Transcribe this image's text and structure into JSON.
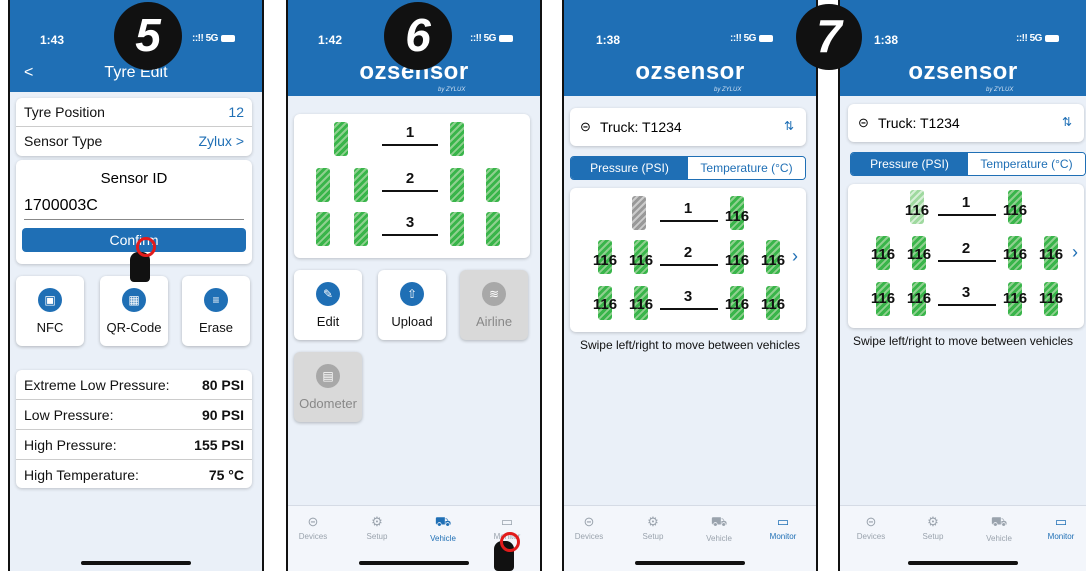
{
  "steps": [
    "5",
    "6",
    "7"
  ],
  "status": {
    "times": [
      "1:43",
      "1:42",
      "1:38",
      "1:38"
    ],
    "signal": "::!! 5G"
  },
  "logo": {
    "text": "ozsensor",
    "sub": "by ZYLUX"
  },
  "p1": {
    "title": "Tyre Edit",
    "back": "<",
    "tyre_position_label": "Tyre Position",
    "tyre_position_value": "12",
    "sensor_type_label": "Sensor Type",
    "sensor_type_value": "Zylux >",
    "sensor_id_label": "Sensor ID",
    "sensor_id_value": "1700003C",
    "confirm": "Confirm",
    "tools": [
      "NFC",
      "QR-Code",
      "Erase"
    ],
    "thresholds": [
      {
        "label": "Extreme Low Pressure:",
        "value": "80 PSI"
      },
      {
        "label": "Low Pressure:",
        "value": "90 PSI"
      },
      {
        "label": "High Pressure:",
        "value": "155 PSI"
      },
      {
        "label": "High Temperature:",
        "value": "75 °C"
      }
    ]
  },
  "p2": {
    "axles": [
      "1",
      "2",
      "3"
    ],
    "actions": [
      "Edit",
      "Upload",
      "Airline",
      "Odometer"
    ]
  },
  "monitor": {
    "truck": "Truck: T1234",
    "tab_pressure": "Pressure (PSI)",
    "tab_temperature": "Temperature (°C)",
    "axles": [
      "1",
      "2",
      "3"
    ],
    "tyre_value": "116",
    "hint": "Swipe left/right to move between vehicles"
  },
  "nav": [
    "Devices",
    "Setup",
    "Vehicle",
    "Monitor"
  ],
  "colors": {
    "primary": "#1f6fb5",
    "tyre": "#39b54a",
    "marker": "#e21b1b"
  }
}
